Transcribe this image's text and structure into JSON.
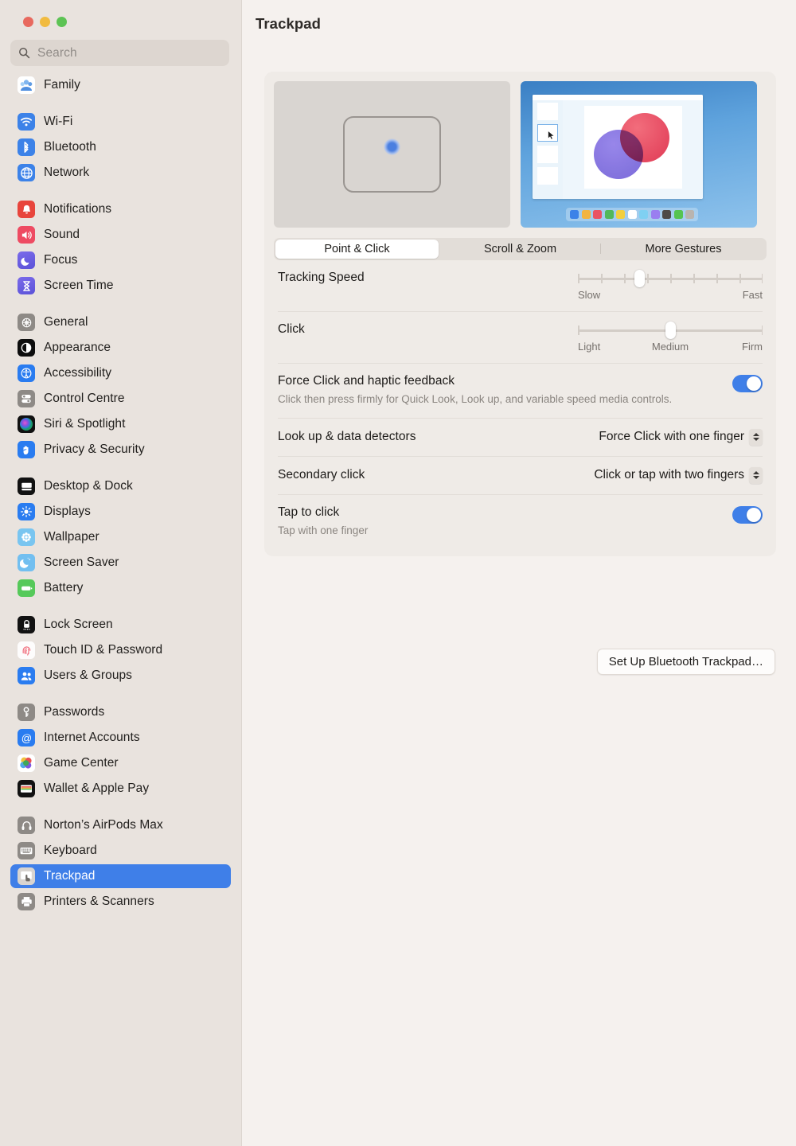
{
  "window": {
    "traffic_lights": [
      {
        "name": "close",
        "color": "#e8695e"
      },
      {
        "name": "minimize",
        "color": "#f1bb40"
      },
      {
        "name": "zoom",
        "color": "#5dc354"
      }
    ]
  },
  "search": {
    "placeholder": "Search",
    "value": ""
  },
  "sidebar": {
    "groups": [
      {
        "items": [
          {
            "label": "Family",
            "icon": "family-icon"
          }
        ]
      },
      {
        "items": [
          {
            "label": "Wi-Fi",
            "icon": "wifi-icon"
          },
          {
            "label": "Bluetooth",
            "icon": "bluetooth-icon"
          },
          {
            "label": "Network",
            "icon": "network-icon"
          }
        ]
      },
      {
        "items": [
          {
            "label": "Notifications",
            "icon": "notifications-icon"
          },
          {
            "label": "Sound",
            "icon": "sound-icon"
          },
          {
            "label": "Focus",
            "icon": "focus-icon"
          },
          {
            "label": "Screen Time",
            "icon": "screen-time-icon"
          }
        ]
      },
      {
        "items": [
          {
            "label": "General",
            "icon": "general-icon"
          },
          {
            "label": "Appearance",
            "icon": "appearance-icon"
          },
          {
            "label": "Accessibility",
            "icon": "accessibility-icon"
          },
          {
            "label": "Control Centre",
            "icon": "control-centre-icon"
          },
          {
            "label": "Siri & Spotlight",
            "icon": "siri-icon"
          },
          {
            "label": "Privacy & Security",
            "icon": "privacy-icon"
          }
        ]
      },
      {
        "items": [
          {
            "label": "Desktop & Dock",
            "icon": "desktop-dock-icon"
          },
          {
            "label": "Displays",
            "icon": "displays-icon"
          },
          {
            "label": "Wallpaper",
            "icon": "wallpaper-icon"
          },
          {
            "label": "Screen Saver",
            "icon": "screen-saver-icon"
          },
          {
            "label": "Battery",
            "icon": "battery-icon"
          }
        ]
      },
      {
        "items": [
          {
            "label": "Lock Screen",
            "icon": "lock-screen-icon"
          },
          {
            "label": "Touch ID & Password",
            "icon": "touch-id-icon"
          },
          {
            "label": "Users & Groups",
            "icon": "users-groups-icon"
          }
        ]
      },
      {
        "items": [
          {
            "label": "Passwords",
            "icon": "passwords-icon"
          },
          {
            "label": "Internet Accounts",
            "icon": "internet-accounts-icon"
          },
          {
            "label": "Game Center",
            "icon": "game-center-icon"
          },
          {
            "label": "Wallet & Apple Pay",
            "icon": "wallet-icon"
          }
        ]
      },
      {
        "items": [
          {
            "label": "Norton’s AirPods Max",
            "icon": "airpods-max-icon"
          },
          {
            "label": "Keyboard",
            "icon": "keyboard-icon"
          },
          {
            "label": "Trackpad",
            "icon": "trackpad-icon",
            "selected": true
          },
          {
            "label": "Printers & Scanners",
            "icon": "printers-scanners-icon"
          }
        ]
      }
    ]
  },
  "main": {
    "title": "Trackpad",
    "preview": {
      "left_alt": "trackpad-illustration",
      "right_alt": "point-and-click-animation",
      "swatch_colors": [
        "#3c82e8",
        "#f2b441",
        "#ea5364",
        "#51b85a",
        "#f2cf3f",
        "#ffffff",
        "#7fd0f2",
        "#9a7ff0",
        "#4e4b48",
        "#55c451",
        "#b9b4af"
      ]
    },
    "tabs": [
      {
        "label": "Point & Click",
        "active": true
      },
      {
        "label": "Scroll & Zoom",
        "active": false
      },
      {
        "label": "More Gestures",
        "active": false
      }
    ],
    "tracking_speed": {
      "label": "Tracking Speed",
      "min_label": "Slow",
      "max_label": "Fast",
      "ticks": 9,
      "value_index": 3
    },
    "click": {
      "label": "Click",
      "min_label": "Light",
      "mid_label": "Medium",
      "max_label": "Firm",
      "value_index": 1
    },
    "force_click": {
      "label": "Force Click and haptic feedback",
      "description": "Click then press firmly for Quick Look, Look up, and variable speed media controls.",
      "enabled": true,
      "state_text": "on"
    },
    "look_up": {
      "label": "Look up & data detectors",
      "value": "Force Click with one finger"
    },
    "secondary_click": {
      "label": "Secondary click",
      "value": "Click or tap with two fingers"
    },
    "tap_to_click": {
      "label": "Tap to click",
      "description": "Tap with one finger",
      "enabled": true,
      "state_text": "on"
    },
    "setup_button": "Set Up Bluetooth Trackpad…"
  },
  "colors": {
    "accent": "#3f7fe8",
    "window_bg": "#f5f1ee",
    "sidebar_bg": "#e9e3de",
    "card_bg": "#efebe7"
  }
}
